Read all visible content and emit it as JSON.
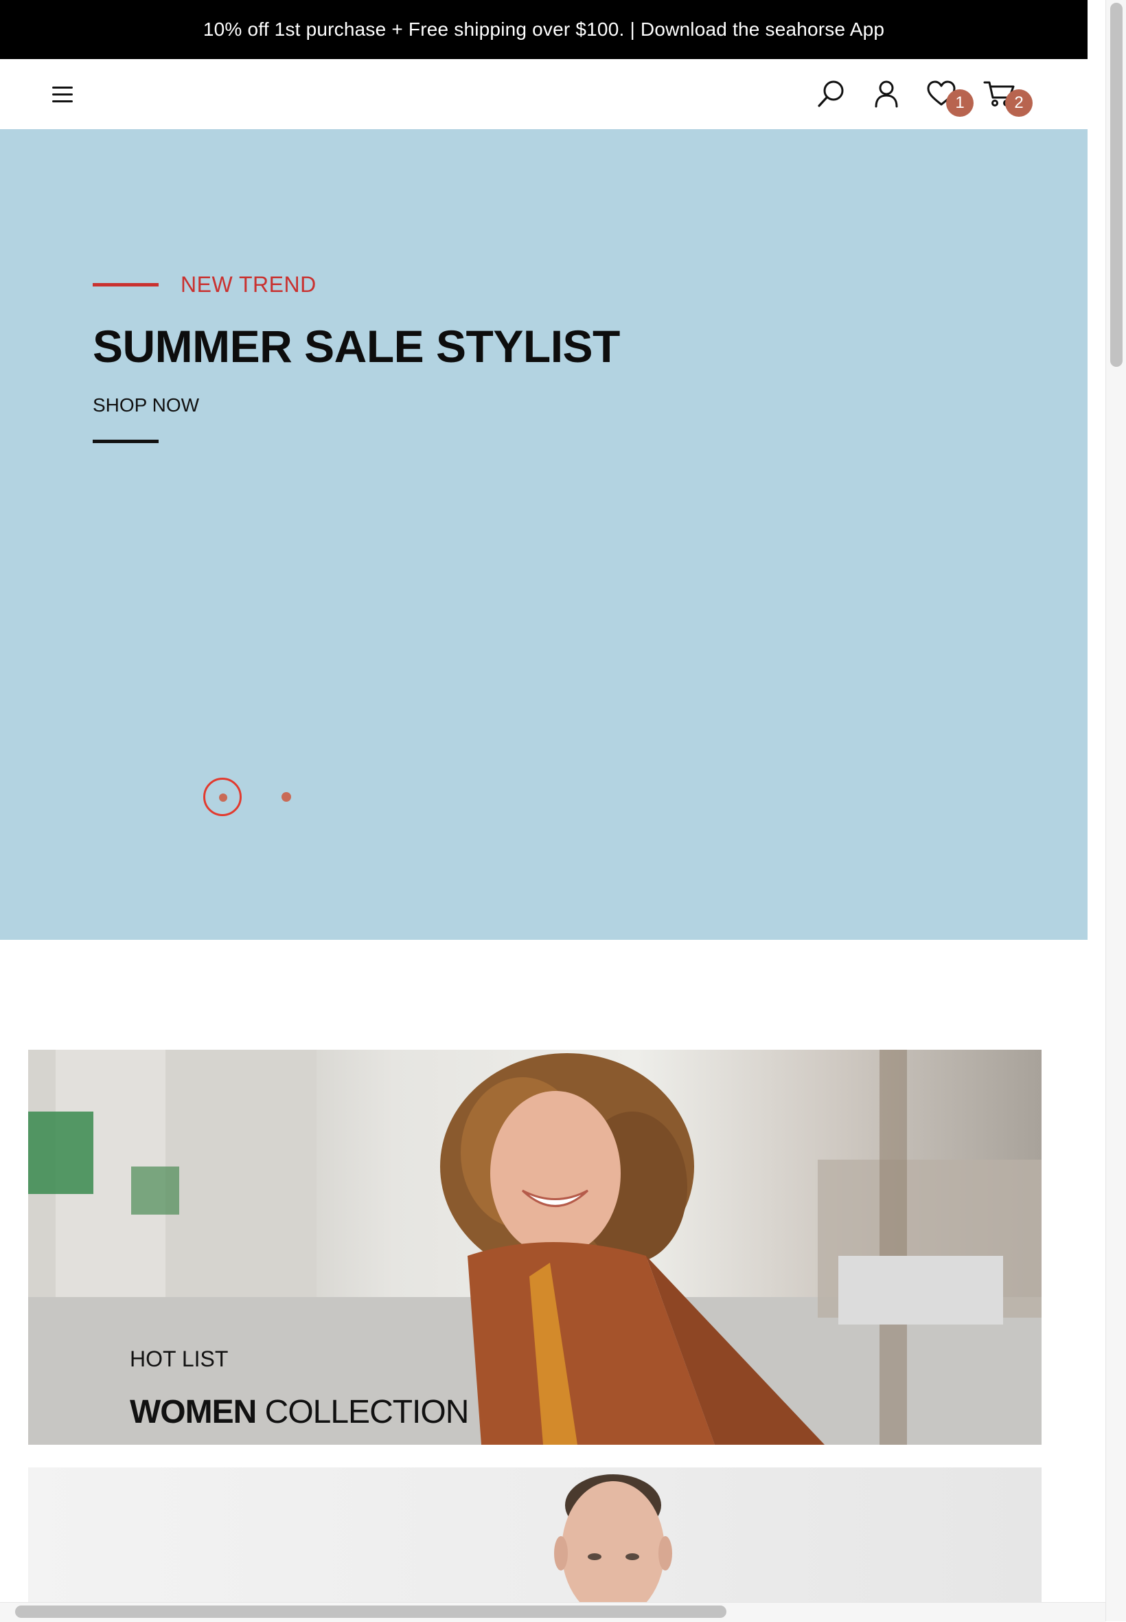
{
  "announcement": {
    "text": "10% off 1st purchase + Free shipping over $100. | Download the seahorse App"
  },
  "header": {
    "menu_icon": "hamburger-menu-icon",
    "search_icon": "search-icon",
    "account_icon": "user-icon",
    "wishlist_icon": "heart-icon",
    "wishlist_count": "1",
    "cart_icon": "cart-icon",
    "cart_count": "2",
    "badge_color": "#b8644f"
  },
  "hero": {
    "background": "#b3d3e1",
    "eyebrow": "NEW TREND",
    "title": "SUMMER SALE STYLIST",
    "cta": "SHOP NOW",
    "accent_color": "#c9312f",
    "slides_total": 2,
    "active_slide": 1
  },
  "banners": [
    {
      "subtitle": "HOT LIST",
      "title_bold": "WOMEN",
      "title_light": "COLLECTION"
    }
  ]
}
